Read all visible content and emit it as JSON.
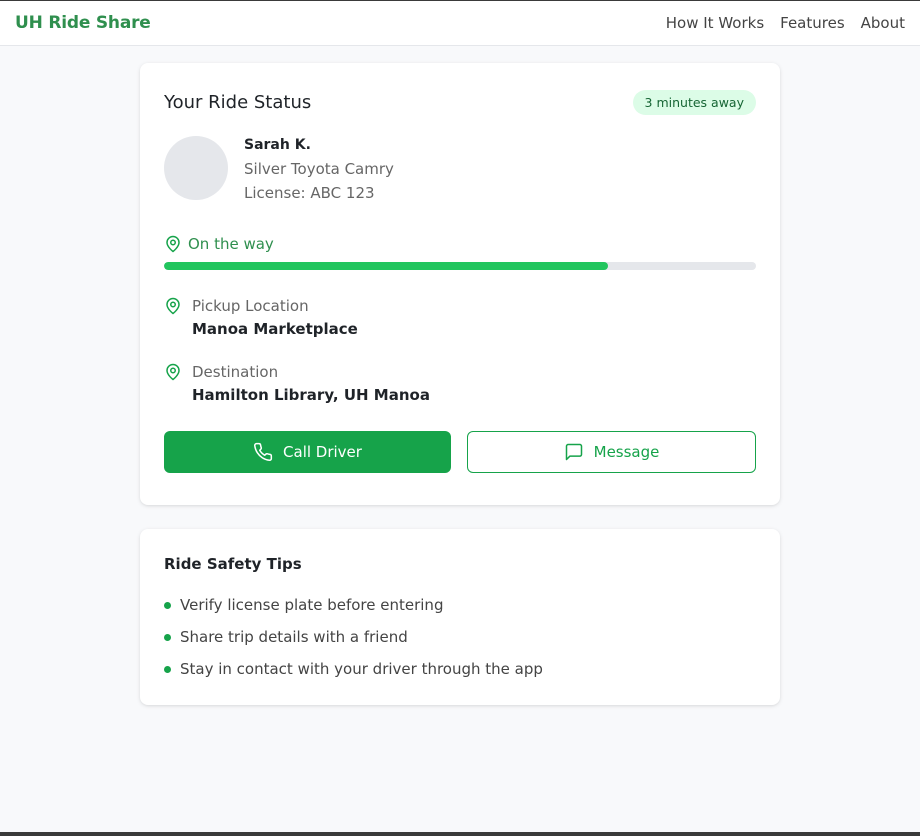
{
  "navbar": {
    "brand": "UH Ride Share",
    "links": [
      "How It Works",
      "Features",
      "About"
    ]
  },
  "ride_status": {
    "title": "Your Ride Status",
    "eta": "3 minutes away",
    "driver": {
      "name": "Sarah K.",
      "vehicle": "Silver Toyota Camry",
      "license": "License: ABC 123"
    },
    "progress": {
      "label": "On the way",
      "fraction": 0.75
    },
    "pickup": {
      "label": "Pickup Location",
      "value": "Manoa Marketplace"
    },
    "destination": {
      "label": "Destination",
      "value": "Hamilton Library, UH Manoa"
    },
    "actions": {
      "call": "Call Driver",
      "message": "Message"
    }
  },
  "safety_tips": {
    "title": "Ride Safety Tips",
    "items": [
      "Verify license plate before entering",
      "Share trip details with a friend",
      "Stay in contact with your driver through the app"
    ]
  },
  "colors": {
    "accent": "#16a34a",
    "progress": "#22c55e",
    "badge_bg": "#dcfce7"
  },
  "icons": {
    "location": "map-pin-icon",
    "call": "phone-icon",
    "message": "chat-bubble-icon"
  }
}
